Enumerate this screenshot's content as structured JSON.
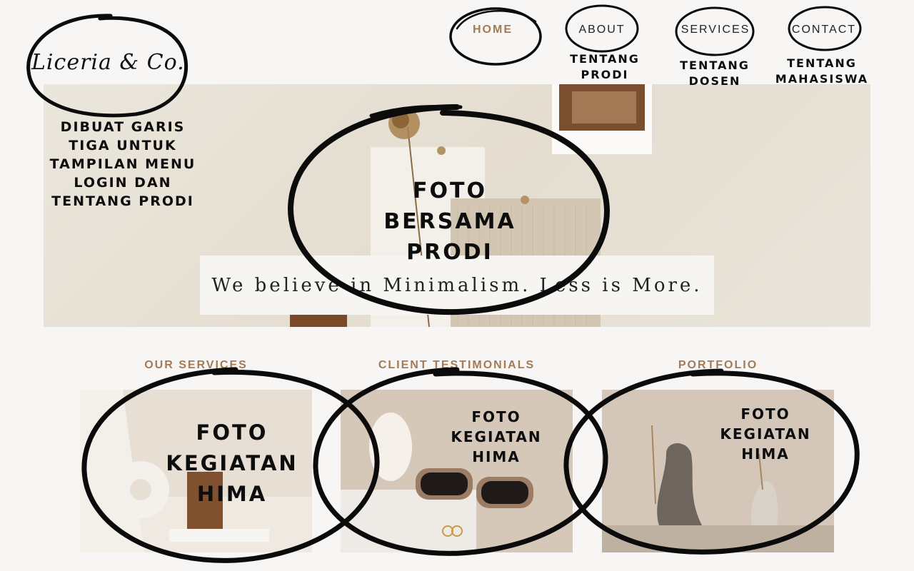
{
  "brand": {
    "logo_text": "Liceria & Co."
  },
  "nav": {
    "items": [
      {
        "label": "HOME",
        "active": true
      },
      {
        "label": "ABOUT",
        "active": false
      },
      {
        "label": "SERVICES",
        "active": false
      },
      {
        "label": "CONTACT",
        "active": false
      }
    ]
  },
  "annotations": {
    "about_note": "TENTANG PRODI",
    "services_note": "TENTANG DOSEN",
    "contact_note": "TENTANG MAHASISWA",
    "menu_note": "DIBUAT GARIS TIGA UNTUK TAMPILAN MENU LOGIN DAN TENTANG PRODI",
    "hero_note": "FOTO BERSAMA PRODI",
    "card1_note": "FOTO KEGIATAN HIMA",
    "card2_note": "FOTO KEGIATAN HIMA",
    "card3_note": "FOTO KEGIATAN HIMA"
  },
  "hero": {
    "tagline": "We believe in Minimalism. Less is More."
  },
  "sections": [
    {
      "title": "OUR SERVICES"
    },
    {
      "title": "CLIENT TESTIMONIALS"
    },
    {
      "title": "PORTFOLIO"
    }
  ],
  "colors": {
    "accent": "#a27b58",
    "background": "#f8f6f4",
    "ink": "#0d0d0d"
  }
}
